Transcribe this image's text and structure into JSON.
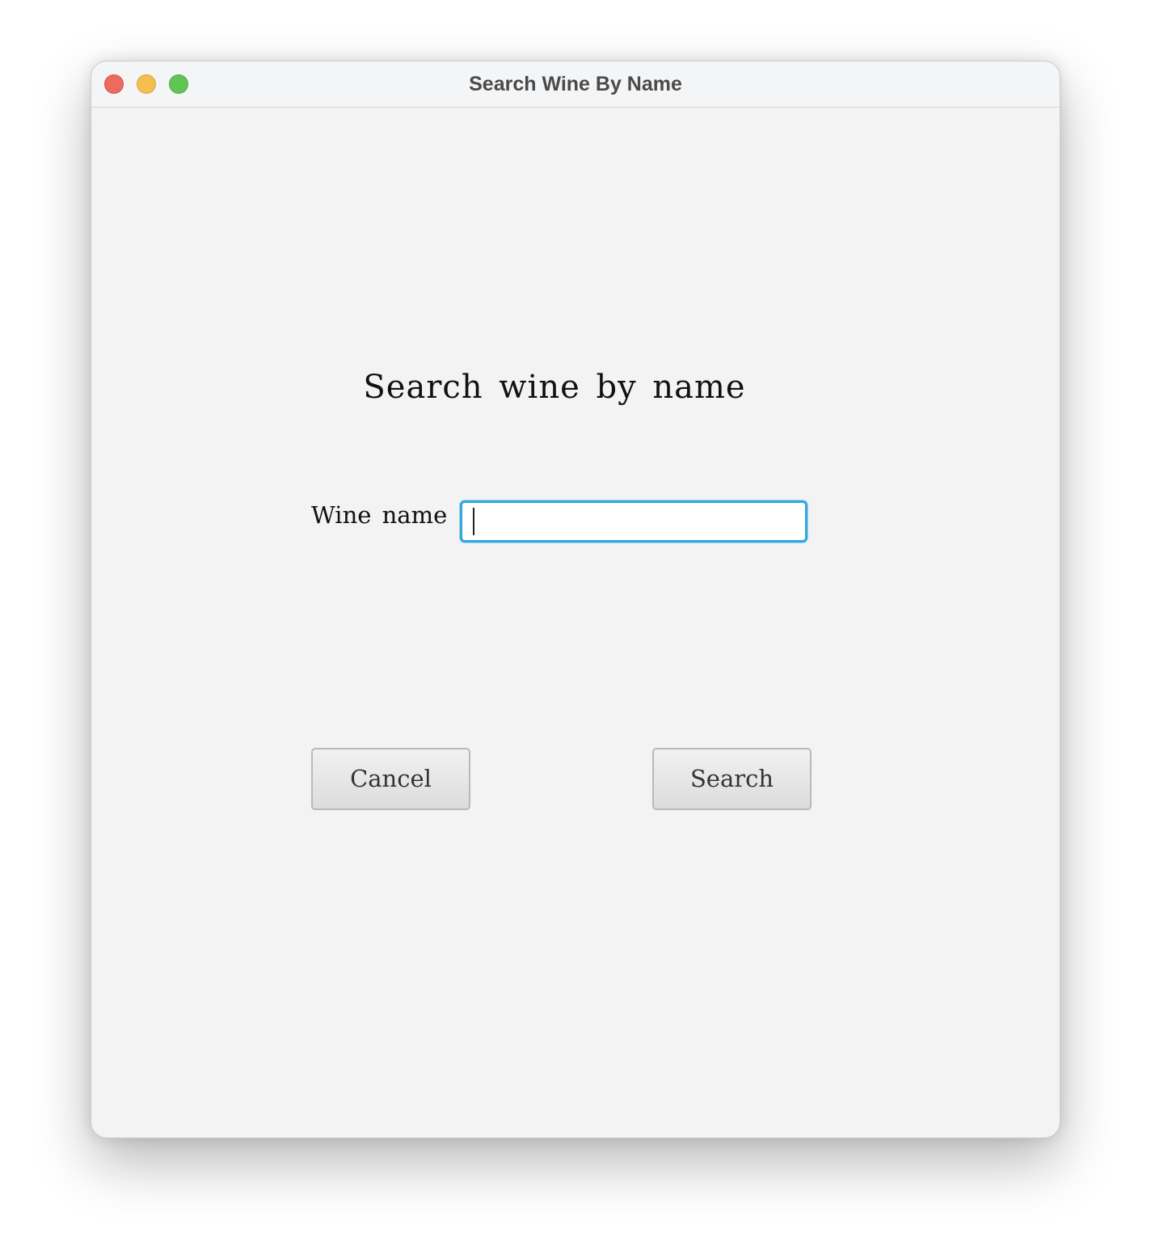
{
  "window": {
    "title": "Search Wine By Name",
    "traffic_lights": {
      "close_color": "#ec6a5e",
      "minimize_color": "#f4bf4f",
      "maximize_color": "#61c554"
    }
  },
  "form": {
    "heading": "Search wine by name",
    "wine_name_label": "Wine name",
    "wine_name_value": "",
    "wine_name_placeholder": "",
    "focus_color": "#33a8dd"
  },
  "buttons": {
    "cancel_label": "Cancel",
    "search_label": "Search"
  }
}
